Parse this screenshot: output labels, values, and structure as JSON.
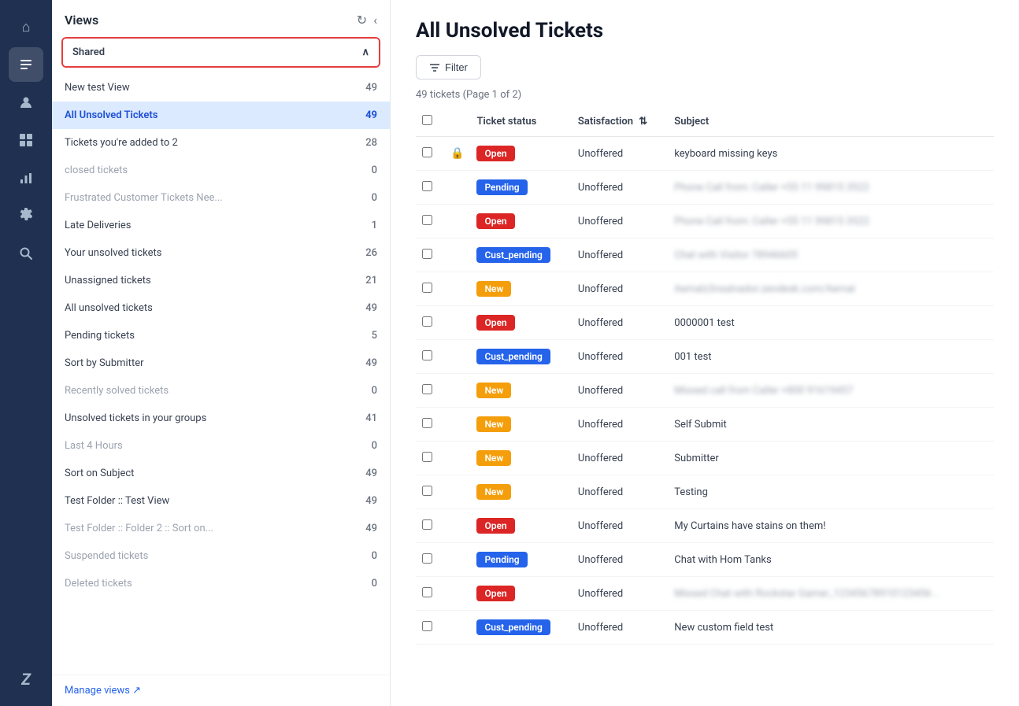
{
  "nav": {
    "items": [
      {
        "name": "home-icon",
        "icon": "⌂",
        "active": false
      },
      {
        "name": "tickets-icon",
        "icon": "☰",
        "active": true
      },
      {
        "name": "users-icon",
        "icon": "👤",
        "active": false
      },
      {
        "name": "reporting-icon",
        "icon": "⊞",
        "active": false
      },
      {
        "name": "charts-icon",
        "icon": "📊",
        "active": false
      },
      {
        "name": "settings-icon",
        "icon": "⚙",
        "active": false
      },
      {
        "name": "search-icon",
        "icon": "🔍",
        "active": false
      }
    ],
    "bottom": [
      {
        "name": "zendesk-logo",
        "icon": "Z",
        "active": false
      }
    ]
  },
  "sidebar": {
    "title": "Views",
    "refresh_label": "↻",
    "collapse_label": "‹",
    "shared_label": "Shared",
    "items": [
      {
        "label": "New test View",
        "count": "49",
        "active": false,
        "grayed": false
      },
      {
        "label": "All Unsolved Tickets",
        "count": "49",
        "active": true,
        "grayed": false
      },
      {
        "label": "Tickets you're added to 2",
        "count": "28",
        "active": false,
        "grayed": false
      },
      {
        "label": "closed tickets",
        "count": "0",
        "active": false,
        "grayed": true
      },
      {
        "label": "Frustrated Customer Tickets Nee...",
        "count": "0",
        "active": false,
        "grayed": true
      },
      {
        "label": "Late Deliveries",
        "count": "1",
        "active": false,
        "grayed": false
      },
      {
        "label": "Your unsolved tickets",
        "count": "26",
        "active": false,
        "grayed": false
      },
      {
        "label": "Unassigned tickets",
        "count": "21",
        "active": false,
        "grayed": false
      },
      {
        "label": "All unsolved tickets",
        "count": "49",
        "active": false,
        "grayed": false
      },
      {
        "label": "Pending tickets",
        "count": "5",
        "active": false,
        "grayed": false
      },
      {
        "label": "Sort by Submitter",
        "count": "49",
        "active": false,
        "grayed": false
      },
      {
        "label": "Recently solved tickets",
        "count": "0",
        "active": false,
        "grayed": true
      },
      {
        "label": "Unsolved tickets in your groups",
        "count": "41",
        "active": false,
        "grayed": false
      },
      {
        "label": "Last 4 Hours",
        "count": "0",
        "active": false,
        "grayed": true
      },
      {
        "label": "Sort on Subject",
        "count": "49",
        "active": false,
        "grayed": false
      },
      {
        "label": "Test Folder :: Test View",
        "count": "49",
        "active": false,
        "grayed": false
      },
      {
        "label": "Test Folder :: Folder 2 :: Sort on...",
        "count": "49",
        "active": false,
        "grayed": true
      },
      {
        "label": "Suspended tickets",
        "count": "0",
        "active": false,
        "grayed": true
      },
      {
        "label": "Deleted tickets",
        "count": "0",
        "active": false,
        "grayed": true
      }
    ],
    "manage_views": "Manage views ↗"
  },
  "main": {
    "title": "All Unsolved Tickets",
    "filter_button": "Filter",
    "ticket_count_text": "49 tickets  (Page 1 of 2)",
    "columns": {
      "check": "",
      "lock": "",
      "status": "Ticket status",
      "satisfaction": "Satisfaction",
      "subject": "Subject"
    },
    "tickets": [
      {
        "status": "Open",
        "status_type": "open",
        "satisfaction": "Unoffered",
        "subject": "keyboard missing keys",
        "blurred": false,
        "locked": true
      },
      {
        "status": "Pending",
        "status_type": "pending",
        "satisfaction": "Unoffered",
        "subject": "Phone Call from: Caller +55 11 99815 3522",
        "blurred": true,
        "locked": false
      },
      {
        "status": "Open",
        "status_type": "open",
        "satisfaction": "Unoffered",
        "subject": "Phone Call from: Caller +55 11 99815 3522",
        "blurred": true,
        "locked": false
      },
      {
        "status": "Cust_pending",
        "status_type": "cust-pending",
        "satisfaction": "Unoffered",
        "subject": "Chat with Visitor 78946605",
        "blurred": true,
        "locked": false
      },
      {
        "status": "New",
        "status_type": "new",
        "satisfaction": "Unoffered",
        "subject": "Aernalz3nsalvador.zendesk.com/Aernaì",
        "blurred": true,
        "locked": false
      },
      {
        "status": "Open",
        "status_type": "open",
        "satisfaction": "Unoffered",
        "subject": "0000001 test",
        "blurred": false,
        "locked": false
      },
      {
        "status": "Cust_pending",
        "status_type": "cust-pending",
        "satisfaction": "Unoffered",
        "subject": "001 test",
        "blurred": false,
        "locked": false
      },
      {
        "status": "New",
        "status_type": "new",
        "satisfaction": "Unoffered",
        "subject": "Missed call from Caller +800 91619457",
        "blurred": true,
        "locked": false
      },
      {
        "status": "New",
        "status_type": "new",
        "satisfaction": "Unoffered",
        "subject": "Self Submit",
        "blurred": false,
        "locked": false
      },
      {
        "status": "New",
        "status_type": "new",
        "satisfaction": "Unoffered",
        "subject": "Submitter",
        "blurred": false,
        "locked": false
      },
      {
        "status": "New",
        "status_type": "new",
        "satisfaction": "Unoffered",
        "subject": "Testing",
        "blurred": false,
        "locked": false
      },
      {
        "status": "Open",
        "status_type": "open",
        "satisfaction": "Unoffered",
        "subject": "My Curtains have stains on them!",
        "blurred": false,
        "locked": false
      },
      {
        "status": "Pending",
        "status_type": "pending",
        "satisfaction": "Unoffered",
        "subject": "Chat with Hom Tanks",
        "blurred": false,
        "locked": false
      },
      {
        "status": "Open",
        "status_type": "open",
        "satisfaction": "Unoffered",
        "subject": "Missed Chat with Rockstar Gamer_12345678910123456 ..",
        "blurred": true,
        "locked": false
      },
      {
        "status": "Cust_pending",
        "status_type": "cust-pending",
        "satisfaction": "Unoffered",
        "subject": "New custom field test",
        "blurred": false,
        "locked": false
      }
    ]
  }
}
